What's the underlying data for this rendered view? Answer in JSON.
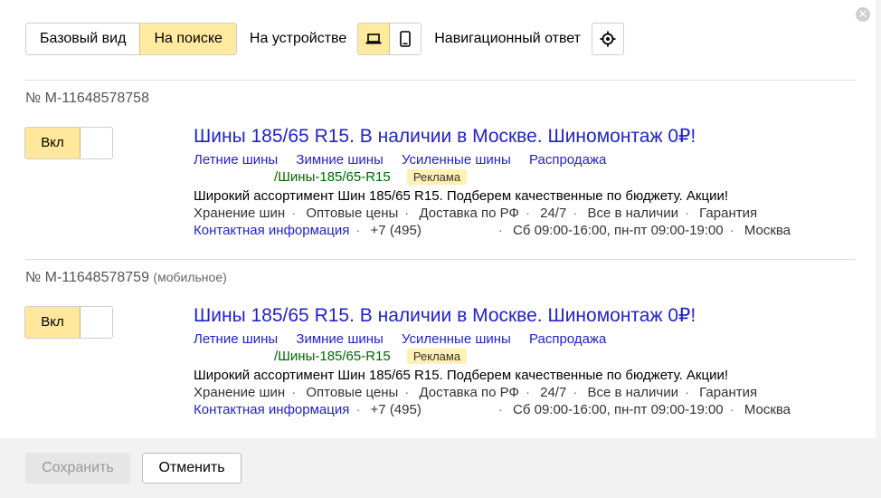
{
  "toolbar": {
    "base_view": "Базовый вид",
    "on_search": "На поиске",
    "on_device": "На устройстве",
    "nav_answer": "Навигационный ответ"
  },
  "ads": [
    {
      "number": "№ М-11648578758",
      "number_sub": "",
      "toggle_label": "Вкл",
      "title": "Шины 185/65 R15. В наличии в Москве. Шиномонтаж 0₽!",
      "sitelinks": [
        "Летние шины",
        "Зимние шины",
        "Усиленные шины",
        "Распродажа"
      ],
      "display_url": "/Шины-185/65-R15",
      "badge": "Реклама",
      "description": "Широкий ассортимент Шин 185/65 R15. Подберем качественные по бюджету. Акции!",
      "features": [
        "Хранение шин",
        "Оптовые цены",
        "Доставка по РФ",
        "24/7",
        "Все в наличии",
        "Гарантия"
      ],
      "contact_link": "Контактная информация",
      "phone": "+7 (495)",
      "hours": "Сб 09:00-16:00, пн-пт 09:00-19:00",
      "city": "Москва"
    },
    {
      "number": "№ М-11648578759",
      "number_sub": "(мобильное)",
      "toggle_label": "Вкл",
      "title": "Шины 185/65 R15. В наличии в Москве. Шиномонтаж 0₽!",
      "sitelinks": [
        "Летние шины",
        "Зимние шины",
        "Усиленные шины",
        "Распродажа"
      ],
      "display_url": "/Шины-185/65-R15",
      "badge": "Реклама",
      "description": "Широкий ассортимент Шин 185/65 R15. Подберем качественные по бюджету. Акции!",
      "features": [
        "Хранение шин",
        "Оптовые цены",
        "Доставка по РФ",
        "24/7",
        "Все в наличии",
        "Гарантия"
      ],
      "contact_link": "Контактная информация",
      "phone": "+7 (495)",
      "hours": "Сб 09:00-16:00, пн-пт 09:00-19:00",
      "city": "Москва"
    }
  ],
  "footer": {
    "save": "Сохранить",
    "cancel": "Отменить"
  },
  "colors": {
    "accent_yellow": "#ffeba0",
    "link_blue": "#2222cc",
    "url_green": "#006600"
  },
  "icons": [
    "close-icon",
    "laptop-icon",
    "phone-icon",
    "target-icon"
  ]
}
